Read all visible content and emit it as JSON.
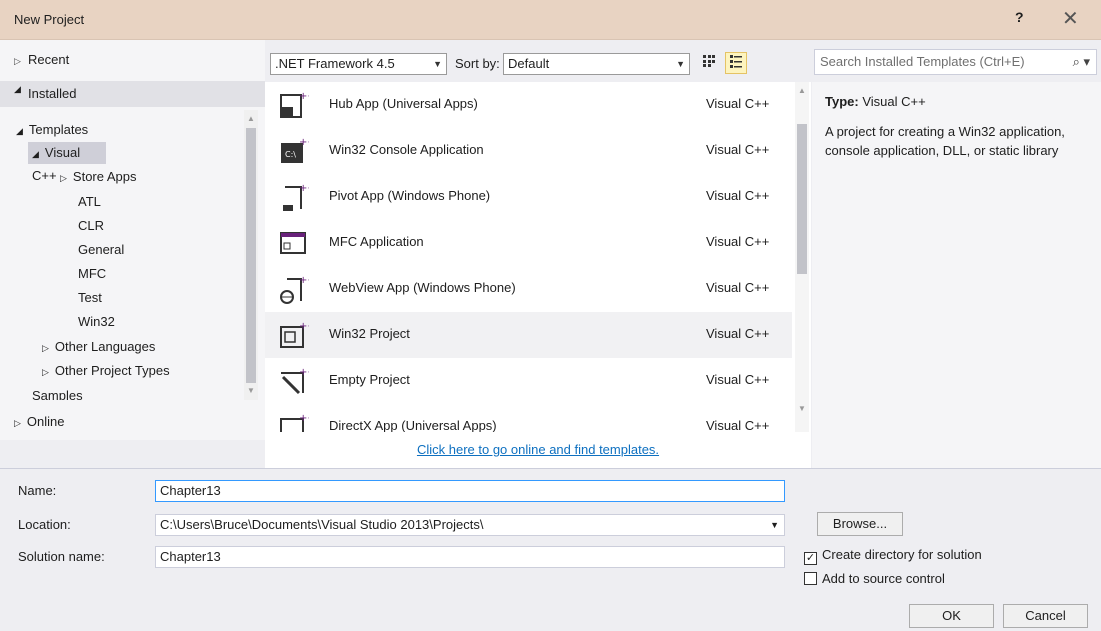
{
  "window": {
    "title": "New Project",
    "help": "?",
    "close": "✕"
  },
  "left_tree": {
    "recent": "Recent",
    "installed": "Installed",
    "templates": "Templates",
    "visual_cpp": "Visual C++",
    "store_apps": "Store Apps",
    "children": [
      "ATL",
      "CLR",
      "General",
      "MFC",
      "Test",
      "Win32"
    ],
    "other_languages": "Other Languages",
    "other_project_types": "Other Project Types",
    "samples": "Samples",
    "online": "Online"
  },
  "toolbar": {
    "framework": ".NET Framework 4.5",
    "sort_label": "Sort by:",
    "sort_value": "Default",
    "grid_icon": "grid-view-icon",
    "list_icon": "list-view-icon"
  },
  "search": {
    "placeholder": "Search Installed Templates (Ctrl+E)",
    "icon": "search-icon"
  },
  "templates": [
    {
      "name": "Hub App (Universal Apps)",
      "lang": "Visual C++"
    },
    {
      "name": "Win32 Console Application",
      "lang": "Visual C++"
    },
    {
      "name": "Pivot App (Windows Phone)",
      "lang": "Visual C++"
    },
    {
      "name": "MFC Application",
      "lang": "Visual C++"
    },
    {
      "name": "WebView App (Windows Phone)",
      "lang": "Visual C++"
    },
    {
      "name": "Win32 Project",
      "lang": "Visual C++"
    },
    {
      "name": "Empty Project",
      "lang": "Visual C++"
    },
    {
      "name": "DirectX App (Universal Apps)",
      "lang": "Visual C++"
    }
  ],
  "online_link": "Click here to go online and find templates.",
  "details": {
    "type_label": "Type:",
    "type_value": "Visual C++",
    "description": "A project for creating a Win32 application, console application, DLL, or static library"
  },
  "form": {
    "name_label": "Name:",
    "name_value": "Chapter13",
    "location_label": "Location:",
    "location_value": "C:\\Users\\Bruce\\Documents\\Visual Studio 2013\\Projects\\",
    "solution_label": "Solution name:",
    "solution_value": "Chapter13",
    "browse": "Browse...",
    "create_dir": "Create directory for solution",
    "create_dir_checked": true,
    "source_control": "Add to source control",
    "source_control_checked": false,
    "ok": "OK",
    "cancel": "Cancel"
  },
  "colors": {
    "titlebar": "#e8d3c2",
    "accent": "#68217a",
    "link": "#0e70c0"
  }
}
